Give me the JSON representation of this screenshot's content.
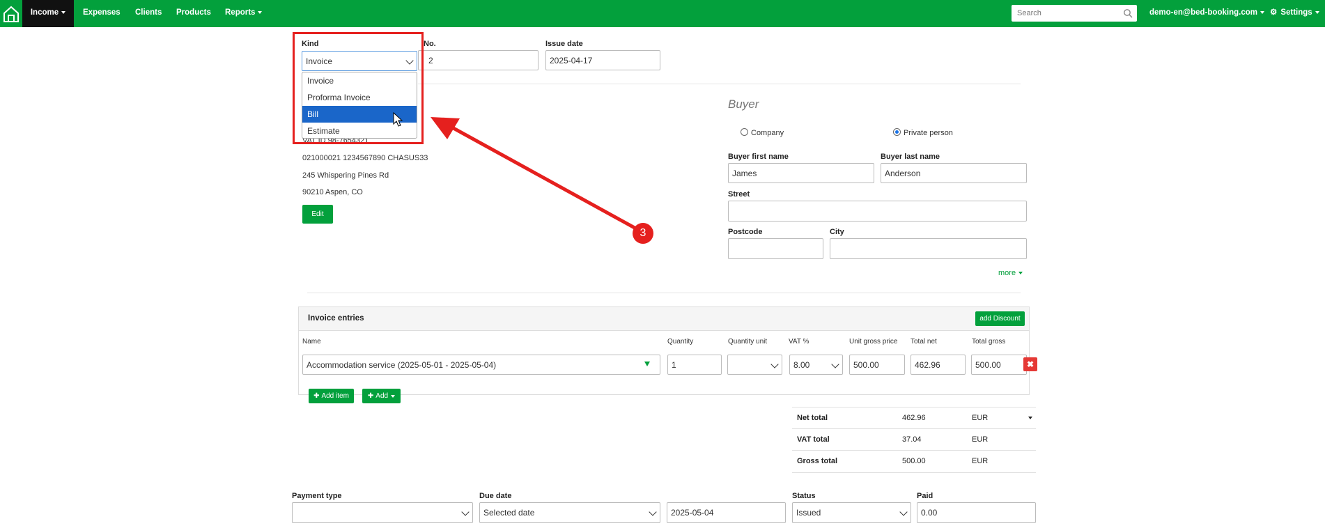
{
  "navbar": {
    "items": [
      {
        "label": "Income"
      },
      {
        "label": "Expenses"
      },
      {
        "label": "Clients"
      },
      {
        "label": "Products"
      },
      {
        "label": "Reports"
      }
    ],
    "search_placeholder": "Search",
    "account": "demo-en@bed-booking.com",
    "settings": "Settings"
  },
  "header": {
    "kind_label": "Kind",
    "kind_value": "Invoice",
    "kind_options": [
      "Invoice",
      "Proforma Invoice",
      "Bill",
      "Estimate"
    ],
    "number_label": "No.",
    "number_value": "2",
    "issue_date_label": "Issue date",
    "issue_date_value": "2025-04-17"
  },
  "seller": {
    "vat_line": "VAT ID 98-7654321",
    "bank_line": "021000021 1234567890 CHASUS33",
    "street": "245 Whispering Pines Rd",
    "city_line": "90210 Aspen, CO",
    "edit_label": "Edit"
  },
  "buyer": {
    "title": "Buyer",
    "company_label": "Company",
    "private_label": "Private person",
    "first_name_label": "Buyer first name",
    "first_name_value": "James",
    "last_name_label": "Buyer last name",
    "last_name_value": "Anderson",
    "street_label": "Street",
    "postcode_label": "Postcode",
    "city_label": "City",
    "more_label": "more"
  },
  "annotation": {
    "number": "3",
    "color": "#e5201e"
  },
  "entries": {
    "title": "Invoice entries",
    "add_discount": "add Discount",
    "columns": [
      "Name",
      "Quantity",
      "Quantity unit",
      "VAT %",
      "Unit gross price",
      "Total net",
      "Total gross"
    ],
    "row": {
      "name": "Accommodation service (2025-05-01 - 2025-05-04)",
      "quantity": "1",
      "unit": "",
      "vat": "8.00",
      "unit_gross": "500.00",
      "total_net": "462.96",
      "total_gross": "500.00"
    },
    "add_item": "Add item",
    "add": "Add"
  },
  "totals": [
    {
      "label": "Net total",
      "value": "462.96",
      "currency": "EUR"
    },
    {
      "label": "VAT total",
      "value": "37.04",
      "currency": "EUR"
    },
    {
      "label": "Gross total",
      "value": "500.00",
      "currency": "EUR"
    }
  ],
  "payment": {
    "type_label": "Payment type",
    "type_value": "",
    "due_label": "Due date",
    "due_value": "Selected date",
    "due_date": "2025-05-04",
    "status_label": "Status",
    "status_value": "Issued",
    "paid_label": "Paid",
    "paid_value": "0.00"
  },
  "colors": {
    "brand": "#03a03c",
    "selected": "#1a66c9",
    "danger": "#e53935",
    "annotation": "#e5201e"
  }
}
